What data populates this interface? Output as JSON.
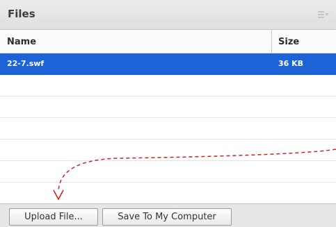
{
  "panel": {
    "title": "Files",
    "menu_icon": "options-menu-icon"
  },
  "table": {
    "columns": [
      "Name",
      "Size"
    ],
    "rows": [
      {
        "name": "22-7.swf",
        "size": "36 KB",
        "selected": true
      }
    ]
  },
  "footer": {
    "upload_label": "Upload File...",
    "save_label": "Save To My Computer"
  },
  "colors": {
    "selection": "#1b63d6",
    "annotation_arrow": "#cc2222"
  }
}
